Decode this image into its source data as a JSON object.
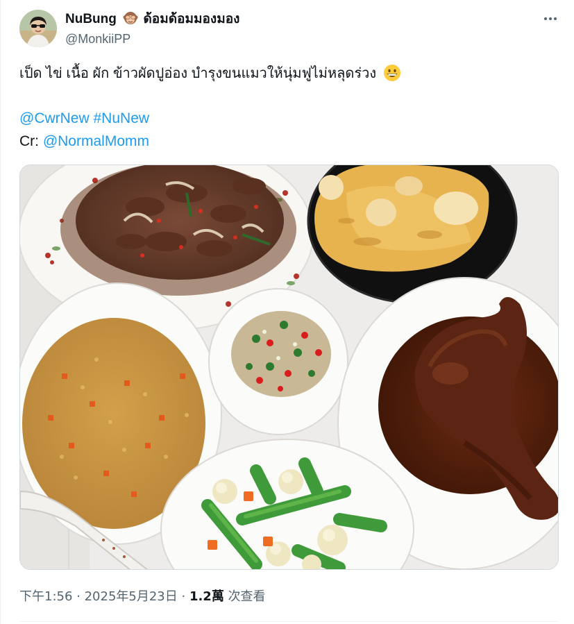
{
  "author": {
    "name": "NuBung",
    "name_suffix": "ด้อมด้อมมองมอง",
    "name_emoji": "see-no-evil-monkey-icon",
    "handle": "@MonkiiPP"
  },
  "tweet": {
    "text": "เป็ด ไข่ เนื้อ ผัก ข้าวผัดปูอ่อง บำรุงขนแมวให้นุ่มฟูไม่หลุดร่วง",
    "text_emoji": "grinning-face-icon",
    "mention_1": "@CwrNew",
    "hashtag": "#NuNew",
    "credit_prefix": "Cr: ",
    "mention_2": "@NormalMomm"
  },
  "photo": {
    "dishes": [
      "stir-fried-beef",
      "rolled-omelette",
      "chili-fish-sauce",
      "crab-fried-rice",
      "braised-duck-leg",
      "stir-fried-vegetables"
    ]
  },
  "meta": {
    "time": "下午1:56",
    "separator": " · ",
    "date": "2025年5月23日",
    "separator_2": " · ",
    "views": "1.2萬",
    "views_label": " 次查看"
  },
  "colors": {
    "link": "#1d9bf0",
    "secondary_text": "#536471",
    "primary_text": "#0f1419"
  }
}
